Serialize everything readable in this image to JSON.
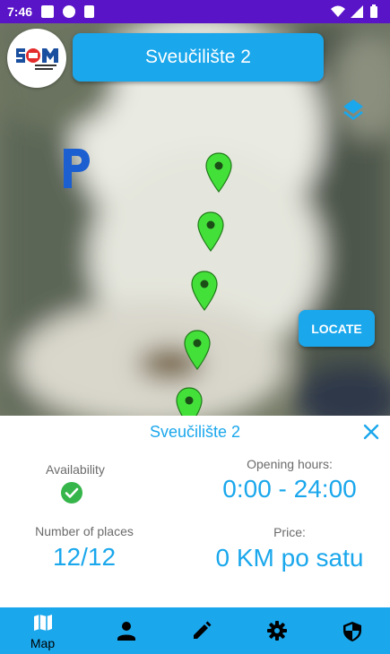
{
  "status_bar": {
    "time": "7:46"
  },
  "header": {
    "title": "Sveučilište 2",
    "logo_icon": "university-logo-icon"
  },
  "map": {
    "layers_icon": "layers-icon",
    "parking_icon": "parking-icon",
    "locate_label": "LOCATE",
    "marker_color": "#44e03a"
  },
  "details": {
    "title": "Sveučilište 2",
    "availability_label": "Availability",
    "availability_icon": "check-circle-icon",
    "opening_hours_label": "Opening hours:",
    "opening_hours_value": "0:00 - 24:00",
    "places_label": "Number of places",
    "places_value": "12/12",
    "price_label": "Price:",
    "price_value": "0 KM po satu"
  },
  "bottom_nav": {
    "items": [
      {
        "label": "Map",
        "icon": "map-icon"
      },
      {
        "label": "",
        "icon": "person-icon"
      },
      {
        "label": "",
        "icon": "pencil-icon"
      },
      {
        "label": "",
        "icon": "gear-icon"
      },
      {
        "label": "",
        "icon": "shield-icon"
      }
    ]
  },
  "colors": {
    "accent": "#1aa7ec",
    "status_bar": "#5a14c8",
    "check": "#36b54a"
  }
}
